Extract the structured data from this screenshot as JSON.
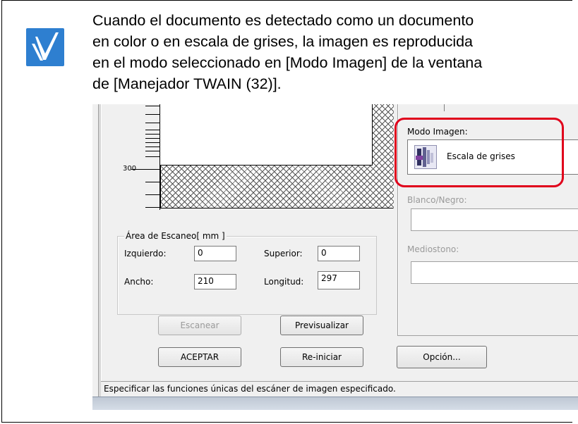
{
  "note": {
    "lines": [
      "Cuando el documento es detectado como un documento",
      "en color o en escala de grises, la imagen es reproducida",
      "en el modo seleccionado en [Modo Imagen] de la ventana",
      "de [Manejador TWAIN (32)]."
    ],
    "icon": "checkmark-icon"
  },
  "preview": {
    "ruler_label": "300"
  },
  "scan_area": {
    "title": "Área de Escaneo[ mm ]",
    "left_label": "Izquierdo:",
    "left_value": "0",
    "top_label": "Superior:",
    "top_value": "0",
    "width_label": "Ancho:",
    "width_value": "210",
    "length_label": "Longitud:",
    "length_value": "297"
  },
  "buttons": {
    "scan": "Escanear",
    "preview": "Previsualizar",
    "ok": "ACEPTAR",
    "reset": "Re-iniciar",
    "option": "Opción..."
  },
  "right_panel": {
    "image_mode_label": "Modo Imagen:",
    "image_mode_value": "Escala de grises",
    "bw_label": "Blanco/Negro:",
    "halftone_label": "Mediostono:"
  },
  "status_bar": {
    "text": "Especificar las funciones únicas del escáner de imagen especificado."
  },
  "colors": {
    "highlight": "#e0001b",
    "icon_bg": "#2e7fd0"
  }
}
